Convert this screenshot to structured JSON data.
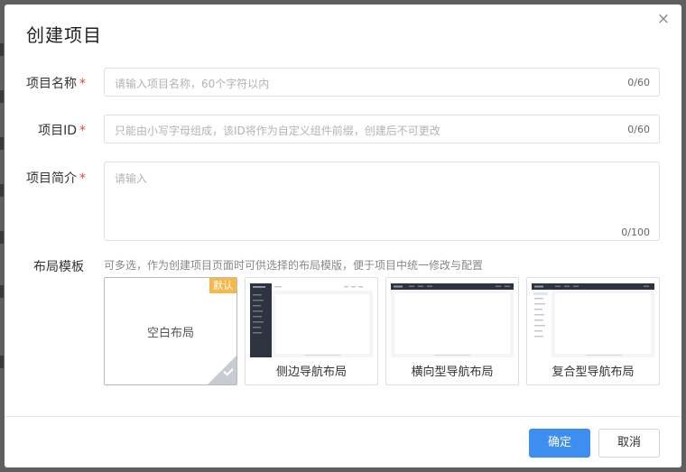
{
  "dialog": {
    "title": "创建项目",
    "close_glyph": "×"
  },
  "form": {
    "name": {
      "label": "项目名称",
      "required_mark": "*",
      "placeholder": "请输入项目名称，60个字符以内",
      "counter": "0/60"
    },
    "id": {
      "label": "项目ID",
      "required_mark": "*",
      "placeholder": "只能由小写字母组成，该ID将作为自定义组件前缀，创建后不可更改",
      "counter": "0/60"
    },
    "intro": {
      "label": "项目简介",
      "required_mark": "*",
      "placeholder": "请输入",
      "counter": "0/100"
    },
    "layout": {
      "label": "布局模板",
      "hint": "可多选，作为创建项目页面时可供选择的布局模版，便于项目中统一修改与配置",
      "templates": [
        {
          "label": "空白布局",
          "badge": "默认",
          "selected": true
        },
        {
          "label": "侧边导航布局"
        },
        {
          "label": "横向型导航布局"
        },
        {
          "label": "复合型导航布局"
        }
      ]
    }
  },
  "footer": {
    "confirm_label": "确定",
    "cancel_label": "取消"
  },
  "colors": {
    "primary": "#3d8ef0",
    "required": "#e0493a",
    "badge": "#f6b84b",
    "nav_dark": "#2d3440"
  },
  "icons": {
    "close": "close-icon",
    "check": "check-icon"
  }
}
